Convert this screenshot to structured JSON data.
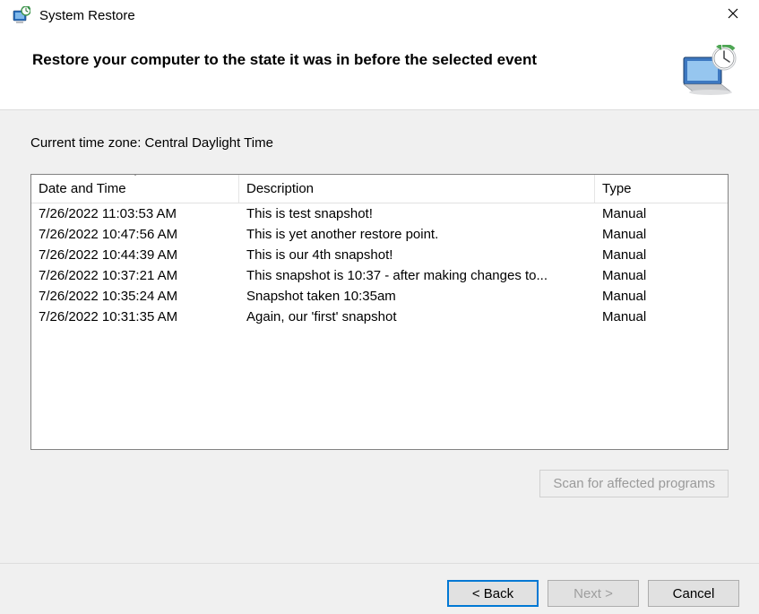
{
  "window": {
    "title": "System Restore"
  },
  "header": {
    "heading": "Restore your computer to the state it was in before the selected event"
  },
  "content": {
    "timezone_label": "Current time zone: Central Daylight Time",
    "columns": {
      "datetime": "Date and Time",
      "description": "Description",
      "type": "Type"
    },
    "rows": [
      {
        "datetime": "7/26/2022 11:03:53 AM",
        "description": "This is test snapshot!",
        "type": "Manual"
      },
      {
        "datetime": "7/26/2022 10:47:56 AM",
        "description": "This is yet another restore point.",
        "type": "Manual"
      },
      {
        "datetime": "7/26/2022 10:44:39 AM",
        "description": "This is our 4th snapshot!",
        "type": "Manual"
      },
      {
        "datetime": "7/26/2022 10:37:21 AM",
        "description": "This snapshot is 10:37 - after making changes to...",
        "type": "Manual"
      },
      {
        "datetime": "7/26/2022 10:35:24 AM",
        "description": "Snapshot taken 10:35am",
        "type": "Manual"
      },
      {
        "datetime": "7/26/2022 10:31:35 AM",
        "description": "Again, our 'first' snapshot",
        "type": "Manual"
      }
    ],
    "scan_button": "Scan for affected programs"
  },
  "footer": {
    "back": "< Back",
    "next": "Next >",
    "cancel": "Cancel"
  }
}
